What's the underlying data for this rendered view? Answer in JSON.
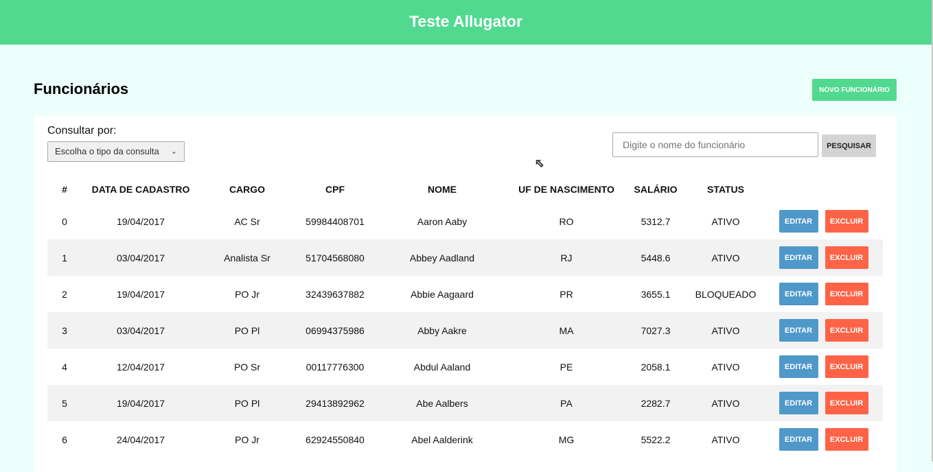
{
  "header": {
    "title": "Teste Allugator"
  },
  "page": {
    "title": "Funcionários",
    "new_button": "NOVO FUNCIONÁRIO"
  },
  "filters": {
    "label": "Consultar por:",
    "select_value": "Escolha o tipo da consulta",
    "search_placeholder": "Digite o nome do funcionário",
    "search_button": "PESQUISAR"
  },
  "table": {
    "columns": [
      "#",
      "DATA DE CADASTRO",
      "CARGO",
      "CPF",
      "NOME",
      "UF DE NASCIMENTO",
      "SALÁRIO",
      "STATUS"
    ],
    "edit_label": "EDITAR",
    "delete_label": "EXCLUIR",
    "rows": [
      [
        "0",
        "19/04/2017",
        "AC Sr",
        "59984408701",
        "Aaron Aaby",
        "RO",
        "5312.7",
        "ATIVO"
      ],
      [
        "1",
        "03/04/2017",
        "Analista Sr",
        "51704568080",
        "Abbey Aadland",
        "RJ",
        "5448.6",
        "ATIVO"
      ],
      [
        "2",
        "19/04/2017",
        "PO Jr",
        "32439637882",
        "Abbie Aagaard",
        "PR",
        "3655.1",
        "BLOQUEADO"
      ],
      [
        "3",
        "03/04/2017",
        "PO Pl",
        "06994375986",
        "Abby Aakre",
        "MA",
        "7027.3",
        "ATIVO"
      ],
      [
        "4",
        "12/04/2017",
        "PO Sr",
        "00117776300",
        "Abdul Aaland",
        "PE",
        "2058.1",
        "ATIVO"
      ],
      [
        "5",
        "19/04/2017",
        "PO Pl",
        "29413892962",
        "Abe Aalbers",
        "PA",
        "2282.7",
        "ATIVO"
      ],
      [
        "6",
        "24/04/2017",
        "PO Jr",
        "62924550840",
        "Abel Aalderink",
        "MG",
        "5522.2",
        "ATIVO"
      ]
    ]
  }
}
